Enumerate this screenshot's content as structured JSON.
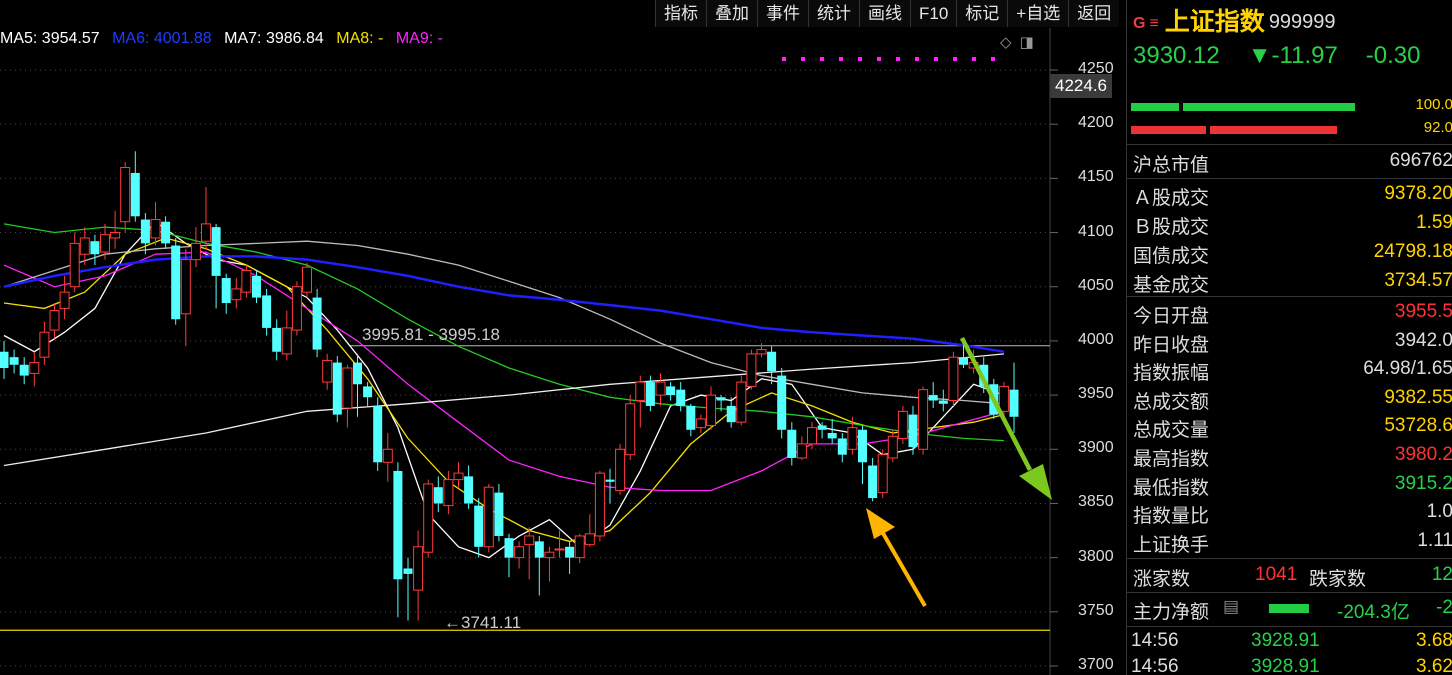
{
  "toolbar": [
    "指标",
    "叠加",
    "事件",
    "统计",
    "画线",
    "F10",
    "标记",
    "+自选",
    "返回"
  ],
  "ma_legend": [
    {
      "text": "MA5: 3954.57",
      "color": "#ffffff"
    },
    {
      "text": "MA6: 4001.88",
      "color": "#1f3cff"
    },
    {
      "text": "MA7: 3986.84",
      "color": "#ffffff"
    },
    {
      "text": "MA8: -",
      "color": "#f5e100"
    },
    {
      "text": "MA9: -",
      "color": "#ff22ff"
    }
  ],
  "chart_controls": {
    "diamond": "◇",
    "panel": "◨"
  },
  "cursor_value": "4224.6",
  "chart_data": {
    "type": "candlestick",
    "ylim": [
      3700,
      4270
    ],
    "yticks": [
      4250,
      4200,
      4150,
      4100,
      4050,
      4000,
      3950,
      3900,
      3850,
      3800,
      3750,
      3700
    ],
    "candles": [
      [
        3990,
        3975,
        4000,
        3965
      ],
      [
        3985,
        3978,
        3992,
        3970
      ],
      [
        3978,
        3968,
        3985,
        3960
      ],
      [
        3970,
        3980,
        3990,
        3958
      ],
      [
        3985,
        4008,
        4018,
        3978
      ],
      [
        4010,
        4028,
        4035,
        4002
      ],
      [
        4030,
        4045,
        4060,
        4020
      ],
      [
        4050,
        4090,
        4100,
        4045
      ],
      [
        4080,
        4095,
        4105,
        4070
      ],
      [
        4092,
        4080,
        4098,
        4070
      ],
      [
        4082,
        4098,
        4108,
        4075
      ],
      [
        4095,
        4100,
        4120,
        4085
      ],
      [
        4110,
        4160,
        4165,
        4100
      ],
      [
        4155,
        4115,
        4175,
        4110
      ],
      [
        4112,
        4090,
        4118,
        4080
      ],
      [
        4095,
        4112,
        4128,
        4088
      ],
      [
        4110,
        4090,
        4115,
        4085
      ],
      [
        4088,
        4020,
        4095,
        4015
      ],
      [
        4025,
        4075,
        4085,
        3995
      ],
      [
        4075,
        4090,
        4105,
        4068
      ],
      [
        4092,
        4108,
        4142,
        4085
      ],
      [
        4105,
        4060,
        4108,
        4030
      ],
      [
        4058,
        4035,
        4062,
        4025
      ],
      [
        4038,
        4048,
        4058,
        4030
      ],
      [
        4045,
        4065,
        4070,
        4040
      ],
      [
        4060,
        4040,
        4065,
        4035
      ],
      [
        4042,
        4012,
        4048,
        4005
      ],
      [
        4012,
        3990,
        4020,
        3982
      ],
      [
        3988,
        4012,
        4028,
        3982
      ],
      [
        4010,
        4050,
        4055,
        4005
      ],
      [
        4045,
        4068,
        4072,
        4040
      ],
      [
        4040,
        3992,
        4048,
        3985
      ],
      [
        3962,
        3982,
        3988,
        3955
      ],
      [
        3980,
        3932,
        3986,
        3925
      ],
      [
        3938,
        3975,
        3978,
        3920
      ],
      [
        3980,
        3960,
        3988,
        3930
      ],
      [
        3958,
        3948,
        3962,
        3940
      ],
      [
        3940,
        3888,
        3948,
        3880
      ],
      [
        3888,
        3900,
        3915,
        3870
      ],
      [
        3880,
        3780,
        3888,
        3745
      ],
      [
        3790,
        3785,
        3800,
        3742
      ],
      [
        3770,
        3810,
        3825,
        3742
      ],
      [
        3805,
        3868,
        3872,
        3800
      ],
      [
        3865,
        3850,
        3875,
        3842
      ],
      [
        3848,
        3872,
        3880,
        3840
      ],
      [
        3872,
        3878,
        3888,
        3865
      ],
      [
        3875,
        3850,
        3885,
        3845
      ],
      [
        3848,
        3810,
        3855,
        3800
      ],
      [
        3810,
        3865,
        3868,
        3805
      ],
      [
        3860,
        3820,
        3868,
        3815
      ],
      [
        3818,
        3800,
        3822,
        3782
      ],
      [
        3800,
        3810,
        3815,
        3790
      ],
      [
        3812,
        3820,
        3828,
        3780
      ],
      [
        3815,
        3800,
        3820,
        3765
      ],
      [
        3800,
        3805,
        3810,
        3778
      ],
      [
        3808,
        3808,
        3825,
        3800
      ],
      [
        3810,
        3800,
        3815,
        3785
      ],
      [
        3800,
        3820,
        3822,
        3795
      ],
      [
        3812,
        3822,
        3840,
        3810
      ],
      [
        3820,
        3878,
        3880,
        3815
      ],
      [
        3872,
        3870,
        3882,
        3850
      ],
      [
        3862,
        3900,
        3905,
        3858
      ],
      [
        3895,
        3942,
        3950,
        3890
      ],
      [
        3945,
        3962,
        3968,
        3920
      ],
      [
        3962,
        3940,
        3968,
        3935
      ],
      [
        3950,
        3962,
        3970,
        3940
      ],
      [
        3958,
        3950,
        3962,
        3945
      ],
      [
        3955,
        3940,
        3962,
        3935
      ],
      [
        3940,
        3918,
        3942,
        3912
      ],
      [
        3920,
        3928,
        3932,
        3915
      ],
      [
        3922,
        3950,
        3958,
        3918
      ],
      [
        3948,
        3945,
        3950,
        3935
      ],
      [
        3940,
        3925,
        3948,
        3920
      ],
      [
        3925,
        3962,
        3968,
        3922
      ],
      [
        3958,
        3988,
        3992,
        3955
      ],
      [
        3988,
        3992,
        3998,
        3985
      ],
      [
        3990,
        3972,
        3995,
        3960
      ],
      [
        3968,
        3918,
        3975,
        3910
      ],
      [
        3918,
        3892,
        3925,
        3885
      ],
      [
        3892,
        3905,
        3912,
        3890
      ],
      [
        3905,
        3920,
        3925,
        3900
      ],
      [
        3922,
        3918,
        3925,
        3910
      ],
      [
        3915,
        3910,
        3928,
        3905
      ],
      [
        3910,
        3895,
        3915,
        3888
      ],
      [
        3900,
        3920,
        3930,
        3895
      ],
      [
        3918,
        3888,
        3922,
        3868
      ],
      [
        3885,
        3855,
        3892,
        3852
      ],
      [
        3860,
        3895,
        3900,
        3855
      ],
      [
        3892,
        3912,
        3918,
        3888
      ],
      [
        3910,
        3935,
        3940,
        3905
      ],
      [
        3932,
        3902,
        3940,
        3895
      ],
      [
        3900,
        3955,
        3958,
        3895
      ],
      [
        3950,
        3945,
        3962,
        3938
      ],
      [
        3945,
        3942,
        3955,
        3935
      ],
      [
        3945,
        3985,
        3990,
        3940
      ],
      [
        3985,
        3978,
        3998,
        3975
      ],
      [
        3975,
        3980,
        3992,
        3970
      ],
      [
        3978,
        3958,
        3985,
        3952
      ],
      [
        3960,
        3932,
        3965,
        3928
      ],
      [
        3935,
        3958,
        3962,
        3930
      ],
      [
        3955,
        3930,
        3980,
        3915
      ]
    ],
    "series": [
      {
        "color": "#ffffff",
        "width": 1.3,
        "points": [
          [
            0,
            4005
          ],
          [
            3,
            3990
          ],
          [
            6,
            4008
          ],
          [
            9,
            4030
          ],
          [
            12,
            4080
          ],
          [
            15,
            4110
          ],
          [
            18,
            4090
          ],
          [
            21,
            4075
          ],
          [
            24,
            4070
          ],
          [
            27,
            4055
          ],
          [
            30,
            4040
          ],
          [
            33,
            4010
          ],
          [
            36,
            3975
          ],
          [
            39,
            3920
          ],
          [
            42,
            3840
          ],
          [
            45,
            3810
          ],
          [
            48,
            3800
          ],
          [
            51,
            3820
          ],
          [
            54,
            3835
          ],
          [
            57,
            3810
          ],
          [
            60,
            3830
          ],
          [
            63,
            3880
          ],
          [
            66,
            3940
          ],
          [
            69,
            3950
          ],
          [
            72,
            3945
          ],
          [
            75,
            3965
          ],
          [
            78,
            3960
          ],
          [
            81,
            3920
          ],
          [
            84,
            3915
          ],
          [
            87,
            3895
          ],
          [
            90,
            3900
          ],
          [
            93,
            3930
          ],
          [
            96,
            3960
          ],
          [
            99,
            3950
          ]
        ]
      },
      {
        "color": "#f5e100",
        "width": 1.3,
        "points": [
          [
            0,
            4035
          ],
          [
            4,
            4030
          ],
          [
            8,
            4045
          ],
          [
            12,
            4080
          ],
          [
            16,
            4095
          ],
          [
            20,
            4085
          ],
          [
            24,
            4070
          ],
          [
            28,
            4050
          ],
          [
            32,
            4010
          ],
          [
            36,
            3965
          ],
          [
            40,
            3910
          ],
          [
            44,
            3870
          ],
          [
            48,
            3845
          ],
          [
            52,
            3825
          ],
          [
            56,
            3815
          ],
          [
            60,
            3825
          ],
          [
            64,
            3860
          ],
          [
            68,
            3905
          ],
          [
            72,
            3935
          ],
          [
            76,
            3952
          ],
          [
            80,
            3940
          ],
          [
            84,
            3925
          ],
          [
            88,
            3915
          ],
          [
            92,
            3920
          ],
          [
            96,
            3925
          ],
          [
            99,
            3932
          ]
        ]
      },
      {
        "color": "#ff22ff",
        "width": 1.3,
        "points": [
          [
            0,
            4070
          ],
          [
            5,
            4050
          ],
          [
            10,
            4060
          ],
          [
            15,
            4080
          ],
          [
            20,
            4082
          ],
          [
            25,
            4060
          ],
          [
            30,
            4030
          ],
          [
            35,
            4000
          ],
          [
            40,
            3960
          ],
          [
            45,
            3925
          ],
          [
            50,
            3890
          ],
          [
            55,
            3875
          ],
          [
            60,
            3865
          ],
          [
            65,
            3862
          ],
          [
            70,
            3862
          ],
          [
            75,
            3880
          ],
          [
            80,
            3905
          ],
          [
            85,
            3905
          ],
          [
            90,
            3912
          ],
          [
            95,
            3925
          ],
          [
            99,
            3935
          ]
        ]
      },
      {
        "color": "#22cc22",
        "width": 1.3,
        "points": [
          [
            0,
            4108
          ],
          [
            5,
            4100
          ],
          [
            10,
            4105
          ],
          [
            15,
            4102
          ],
          [
            20,
            4090
          ],
          [
            25,
            4082
          ],
          [
            30,
            4070
          ],
          [
            35,
            4048
          ],
          [
            40,
            4020
          ],
          [
            45,
            3995
          ],
          [
            50,
            3975
          ],
          [
            55,
            3960
          ],
          [
            60,
            3948
          ],
          [
            65,
            3942
          ],
          [
            70,
            3938
          ],
          [
            75,
            3935
          ],
          [
            80,
            3930
          ],
          [
            85,
            3922
          ],
          [
            90,
            3915
          ],
          [
            95,
            3910
          ],
          [
            99,
            3908
          ]
        ]
      },
      {
        "color": "#bbbbbb",
        "width": 1.3,
        "points": [
          [
            0,
            4050
          ],
          [
            5,
            4065
          ],
          [
            10,
            4080
          ],
          [
            15,
            4085
          ],
          [
            20,
            4088
          ],
          [
            25,
            4090
          ],
          [
            30,
            4092
          ],
          [
            35,
            4088
          ],
          [
            40,
            4080
          ],
          [
            45,
            4070
          ],
          [
            50,
            4055
          ],
          [
            55,
            4040
          ],
          [
            60,
            4020
          ],
          [
            65,
            3998
          ],
          [
            70,
            3980
          ],
          [
            75,
            3968
          ],
          [
            80,
            3960
          ],
          [
            85,
            3952
          ],
          [
            90,
            3948
          ],
          [
            95,
            3945
          ],
          [
            99,
            3942
          ]
        ]
      },
      {
        "color": "#1f1fff",
        "width": 2.5,
        "points": [
          [
            0,
            4050
          ],
          [
            5,
            4060
          ],
          [
            10,
            4068
          ],
          [
            15,
            4075
          ],
          [
            20,
            4078
          ],
          [
            25,
            4078
          ],
          [
            30,
            4075
          ],
          [
            35,
            4068
          ],
          [
            40,
            4060
          ],
          [
            45,
            4050
          ],
          [
            50,
            4042
          ],
          [
            55,
            4038
          ],
          [
            60,
            4033
          ],
          [
            65,
            4028
          ],
          [
            70,
            4020
          ],
          [
            75,
            4012
          ],
          [
            80,
            4008
          ],
          [
            85,
            4005
          ],
          [
            90,
            4002
          ],
          [
            95,
            3996
          ],
          [
            99,
            3990
          ]
        ]
      },
      {
        "color": "#eeeeee",
        "width": 1.3,
        "points": [
          [
            0,
            3885
          ],
          [
            10,
            3900
          ],
          [
            20,
            3915
          ],
          [
            30,
            3935
          ],
          [
            40,
            3942
          ],
          [
            50,
            3950
          ],
          [
            60,
            3960
          ],
          [
            70,
            3967
          ],
          [
            80,
            3974
          ],
          [
            90,
            3980
          ],
          [
            99,
            3988
          ]
        ]
      }
    ],
    "annotations": {
      "range_label": "3995.81 - 3995.18",
      "range_value": 3995.5,
      "low_label": "←3741.11",
      "low_value": 3733
    }
  },
  "side": {
    "g_icon": "G",
    "menu_icon": "≡",
    "index_name": "上证指数",
    "index_code": "999999",
    "price": "3930.12",
    "change": "▼-11.97",
    "change_pct": "-0.30",
    "bar_labels": [
      "100.0",
      "92.0"
    ],
    "rows1": [
      {
        "k": "沪总市值",
        "v": "696762",
        "c": "#dddddd"
      }
    ],
    "rows2": [
      {
        "k": "Ａ股成交",
        "v": "9378.20",
        "c": "#ffd400"
      },
      {
        "k": "Ｂ股成交",
        "v": "1.59",
        "c": "#ffd400"
      },
      {
        "k": "国债成交",
        "v": "24798.18",
        "c": "#ffd400"
      },
      {
        "k": "基金成交",
        "v": "3734.57",
        "c": "#ffd400"
      }
    ],
    "rows3": [
      {
        "k": "今日开盘",
        "v": "3955.5",
        "c": "#ff3333"
      },
      {
        "k": "昨日收盘",
        "v": "3942.0",
        "c": "#dddddd"
      },
      {
        "k": "指数振幅",
        "v": "64.98/1.65",
        "c": "#dddddd"
      },
      {
        "k": "总成交额",
        "v": "9382.55",
        "c": "#ffd400"
      },
      {
        "k": "总成交量",
        "v": "53728.6",
        "c": "#ffd400"
      },
      {
        "k": "最高指数",
        "v": "3980.2",
        "c": "#ff3333"
      },
      {
        "k": "最低指数",
        "v": "3915.2",
        "c": "#27d14a"
      },
      {
        "k": "指数量比",
        "v": "1.0",
        "c": "#dddddd"
      },
      {
        "k": "上证换手",
        "v": "1.11",
        "c": "#dddddd"
      }
    ],
    "up_label": "涨家数",
    "up_count": "1041",
    "down_label": "跌家数",
    "down_count": "12",
    "main_flow_label": "主力净额",
    "main_flow_value": "-204.3亿",
    "main_flow_extra": "-2",
    "ticks": [
      {
        "time": "14:56",
        "price": "3928.91",
        "vol": "3.68"
      },
      {
        "time": "14:56",
        "price": "3928.91",
        "vol": "3.62"
      }
    ]
  }
}
